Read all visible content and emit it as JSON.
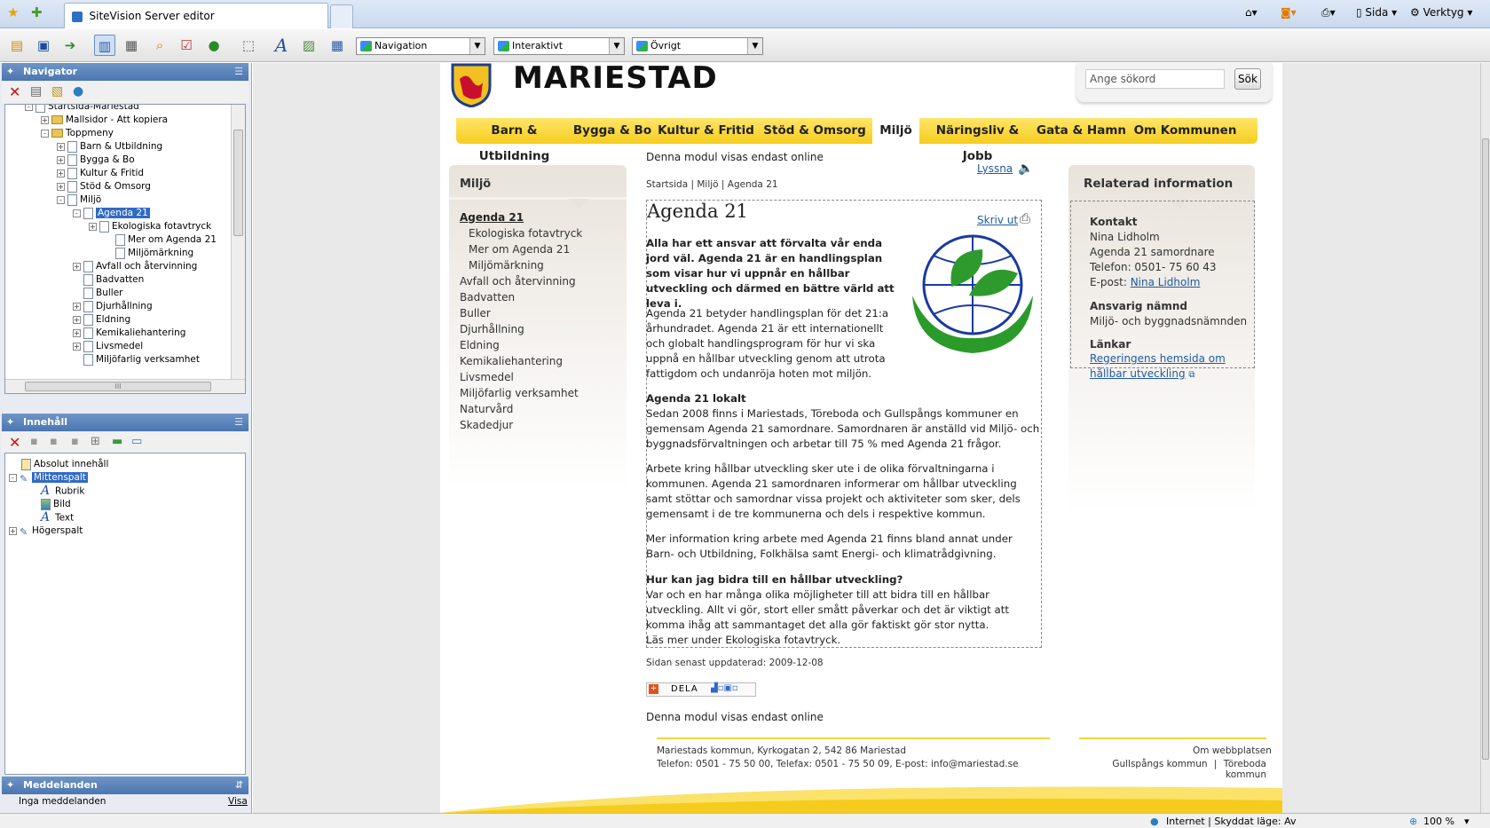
{
  "browser": {
    "tab_title": "SiteVision Server editor",
    "cmd_page": "Sida",
    "cmd_tools": "Verktyg"
  },
  "toolbar": {
    "select_navigation": "Navigation",
    "select_interactive": "Interaktivt",
    "select_other": "Övrigt"
  },
  "navigator": {
    "title": "Navigator",
    "nodes": [
      {
        "label": "Startsida-Mariestad"
      },
      {
        "label": "Mallsidor - Att kopiera"
      },
      {
        "label": "Toppmeny"
      },
      {
        "label": "Barn & Utbildning"
      },
      {
        "label": "Bygga & Bo"
      },
      {
        "label": "Kultur & Fritid"
      },
      {
        "label": "Stöd & Omsorg"
      },
      {
        "label": "Miljö"
      },
      {
        "label": "Agenda 21"
      },
      {
        "label": "Ekologiska fotavtryck"
      },
      {
        "label": "Mer om Agenda 21"
      },
      {
        "label": "Miljömärkning"
      },
      {
        "label": "Avfall och återvinning"
      },
      {
        "label": "Badvatten"
      },
      {
        "label": "Buller"
      },
      {
        "label": "Djurhållning"
      },
      {
        "label": "Eldning"
      },
      {
        "label": "Kemikaliehantering"
      },
      {
        "label": "Livsmedel"
      },
      {
        "label": "Miljöfarlig verksamhet"
      }
    ],
    "scroll_handle": "III"
  },
  "content_panel": {
    "title": "Innehåll",
    "nodes": [
      {
        "label": "Absolut innehåll"
      },
      {
        "label": "Mittenspalt"
      },
      {
        "label": "Rubrik"
      },
      {
        "label": "Bild"
      },
      {
        "label": "Text"
      },
      {
        "label": "Högerspalt"
      }
    ]
  },
  "messages": {
    "title": "Meddelanden",
    "empty": "Inga meddelanden",
    "link": "Visa"
  },
  "site": {
    "brand": "MARIESTAD",
    "search_placeholder": "Ange sökord",
    "search_button": "Sök",
    "nav": [
      "Barn & Utbildning",
      "Bygga & Bo",
      "Kultur & Fritid",
      "Stöd & Omsorg",
      "Miljö",
      "Näringsliv & Jobb",
      "Gata & Hamn",
      "Om Kommunen"
    ],
    "online_notice_top": "Denna modul visas endast online",
    "online_notice_bottom": "Denna modul visas endast online",
    "left_title": "Miljö",
    "left_items": [
      "Agenda 21",
      "Ekologiska fotavtryck",
      "Mer om Agenda 21",
      "Miljömärkning",
      "Avfall och återvinning",
      "Badvatten",
      "Buller",
      "Djurhållning",
      "Eldning",
      "Kemikaliehantering",
      "Livsmedel",
      "Miljöfarlig verksamhet",
      "Naturvård",
      "Skadedjur"
    ],
    "listen": "Lyssna",
    "breadcrumb": "Startsida | Miljö | Agenda 21",
    "print": "Skriv ut",
    "article_title": "Agenda 21",
    "lead": "Alla har ett ansvar att förvalta vår enda jord väl. Agenda 21 är en handlingsplan som visar hur vi uppnår en hållbar utveckling och därmed en bättre värld att leva i.",
    "p1": "Agenda 21 betyder handlingsplan för det 21:a århundradet. Agenda 21 är ett internationellt och globalt handlingsprogram för hur vi ska uppnå en hållbar utveckling genom att utrota fattigdom och undanröja hoten mot miljön.",
    "h2": "Agenda 21 lokalt",
    "p2": "Sedan 2008 finns i Mariestads, Töreboda och Gullspångs kommuner en gemensam Agenda 21 samordnare. Samordnaren är anställd vid Miljö- och byggnadsförvaltningen och arbetar till 75 % med Agenda 21 frågor.",
    "p3": "Arbete kring hållbar utveckling sker ute i de olika förvaltningarna i kommunen. Agenda 21 samordnaren informerar om hållbar utveckling samt stöttar och samordnar vissa projekt och aktiviteter som sker, dels gemensamt i de tre kommunerna och dels i respektive kommun.",
    "p4": "Mer information kring arbete med Agenda 21 finns bland annat under Barn- och Utbildning, Folkhälsa samt Energi- och klimatrådgivning.",
    "h3": "Hur kan jag bidra till en hållbar utveckling?",
    "p5": "Var och en har många olika möjligheter till att bidra till en hållbar utveckling. Allt vi gör, stort eller smått påverkar och det är viktigt att komma ihåg att sammantaget det alla gör faktiskt gör stor nytta.",
    "p6": "Läs mer under Ekologiska fotavtryck.",
    "updated": "Sidan senast uppdaterad: 2009-12-08",
    "share": "DELA",
    "right_title": "Relaterad information",
    "contact_head": "Kontakt",
    "contact_name": "Nina Lidholm",
    "contact_role": "Agenda 21 samordnare",
    "contact_phone": "Telefon: 0501- 75 60 43",
    "contact_email_label": "E-post:",
    "contact_email_link": "Nina Lidholm",
    "board_head": "Ansvarig nämnd",
    "board": "Miljö- och byggnadsnämnden",
    "links_head": "Länkar",
    "link1": "Regeringens hemsida om hållbar utveckling",
    "footer_address": "Mariestads kommun, Kyrkogatan 2, 542 86  Mariestad",
    "footer_contact": "Telefon: 0501 - 75 50 00, Telefax: 0501 - 75 50 09, E-post: info@mariestad.se",
    "footer_about": "Om webbplatsen",
    "footer_gullspang": "Gullspångs kommun",
    "footer_sep": "|",
    "footer_toreboda": "Töreboda kommun"
  },
  "statusbar": {
    "zone": "Internet | Skyddat läge: Av",
    "zoom": "100 %"
  }
}
